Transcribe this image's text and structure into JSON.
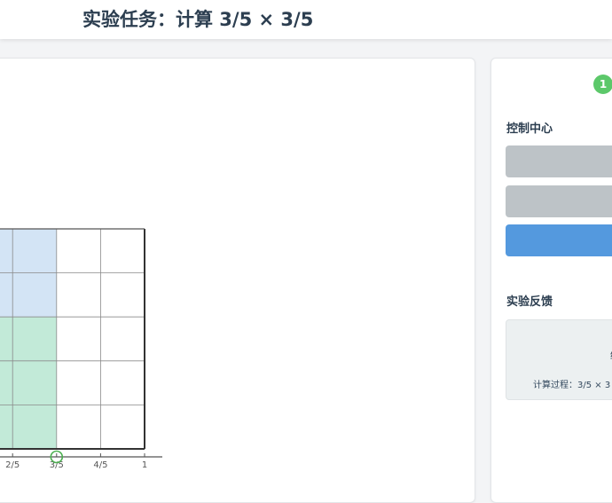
{
  "header": {
    "title": "实验任务：计算 3/5 × 3/5"
  },
  "grid_model": {
    "blue_fill": "#d3e4f5",
    "green_fill": "#c2ead8",
    "axis_ticks": [
      {
        "label": "2/5",
        "value": 0.4
      },
      {
        "label": "3/5",
        "value": 0.6
      },
      {
        "label": "4/5",
        "value": 0.8
      },
      {
        "label": "1",
        "value": 1.0
      }
    ],
    "marker_value": 0.6,
    "marker_color": "#4caf50"
  },
  "controls": {
    "step_badge": "1",
    "section_title": "控制中心",
    "buttons": [
      {
        "color": "#bdc3c7"
      },
      {
        "color": "#bdc3c7"
      },
      {
        "color": "#5499de"
      }
    ]
  },
  "feedback": {
    "section_title": "实验反馈",
    "line1": "结",
    "line2": "计算过程：3/5 × 3"
  }
}
